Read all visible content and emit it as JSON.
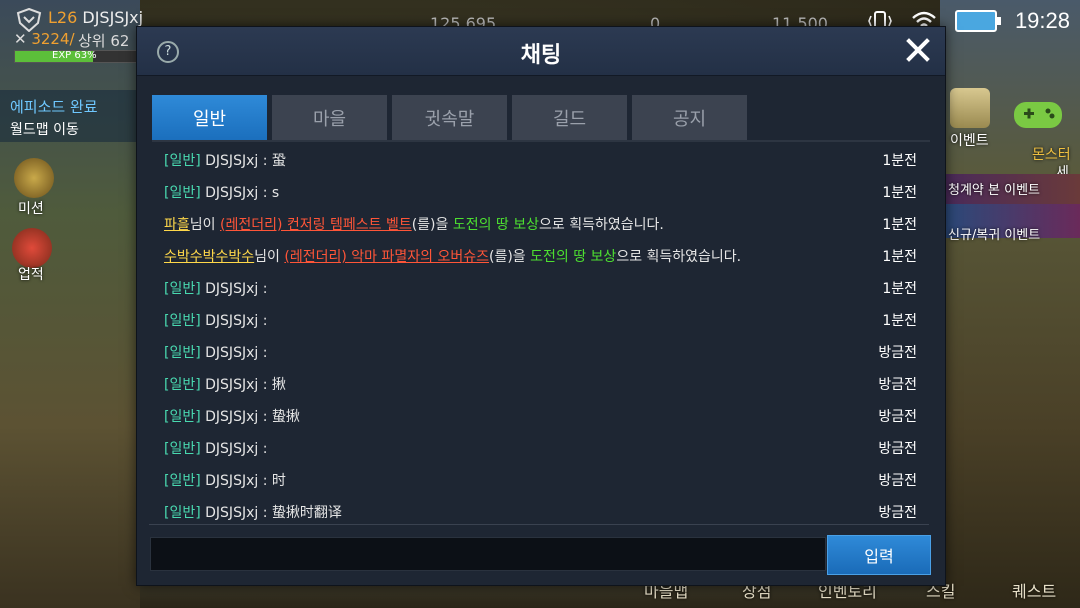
{
  "status_bar": {
    "time": "19:28"
  },
  "hud": {
    "level_name": "DJSJSJxj",
    "level_prefix": "L",
    "level_number": "26",
    "combat": "3224/",
    "rank": "상위 62",
    "exp_label": "EXP 63%",
    "exp_percent": 63,
    "currency_1": "125,695",
    "currency_2": "0",
    "currency_3": "11,500",
    "episode_title": "에피소드 완료",
    "episode_sub": "월드맵 이동",
    "side_mission": "미션",
    "side_achievement": "업적",
    "right_event": "이벤트",
    "right_monster": "몬스터",
    "right_guide": "세시",
    "banner_1": "청계약 본 이벤트",
    "banner_2": "신규/복귀 이벤트",
    "bottom_nav": [
      "마을맵",
      "상점",
      "인벤토리",
      "스킬",
      "퀘스트"
    ]
  },
  "modal": {
    "title": "채팅",
    "help_label": "?",
    "tabs": [
      "일반",
      "마을",
      "귓속말",
      "길드",
      "공지"
    ],
    "active_tab": 0,
    "send_label": "입력",
    "input_value": ""
  },
  "messages": [
    {
      "type": "normal",
      "tag": "[일반]",
      "text": " DJSJSJxj : 蛩",
      "time": "1분전"
    },
    {
      "type": "normal",
      "tag": "[일반]",
      "text": " DJSJSJxj : s",
      "time": "1분전"
    },
    {
      "type": "system",
      "player": "파흘",
      "p1": "님이 ",
      "item": "(레전더리) 컨저링 템페스트 벨트",
      "p2": "(를)을 ",
      "place": "도전의 땅 보상",
      "p3": "으로 획득하였습니다.",
      "time": "1분전"
    },
    {
      "type": "system",
      "player": "수박수박수박수",
      "p1": "님이 ",
      "item": "(레전더리) 악마 파멸자의 오버슈즈",
      "p2": "(를)을 ",
      "place": "도전의 땅 보상",
      "p3": "으로 획득하였습니다.",
      "time": "1분전"
    },
    {
      "type": "normal",
      "tag": "[일반]",
      "text": " DJSJSJxj :",
      "time": "1분전"
    },
    {
      "type": "normal",
      "tag": "[일반]",
      "text": " DJSJSJxj :",
      "time": "1분전"
    },
    {
      "type": "normal",
      "tag": "[일반]",
      "text": " DJSJSJxj :",
      "time": "방금전"
    },
    {
      "type": "normal",
      "tag": "[일반]",
      "text": " DJSJSJxj : 揪",
      "time": "방금전"
    },
    {
      "type": "normal",
      "tag": "[일반]",
      "text": " DJSJSJxj : 蛰揪",
      "time": "방금전"
    },
    {
      "type": "normal",
      "tag": "[일반]",
      "text": " DJSJSJxj :",
      "time": "방금전"
    },
    {
      "type": "normal",
      "tag": "[일반]",
      "text": " DJSJSJxj : 时",
      "time": "방금전"
    },
    {
      "type": "normal",
      "tag": "[일반]",
      "text": " DJSJSJxj : 蛰揪时翻译",
      "time": "방금전"
    }
  ],
  "colors": {
    "accent": "#1b6fbd",
    "tag": "#49d9b0",
    "player": "#ffd84a",
    "item": "#ff5538",
    "place": "#4de030"
  },
  "icons": [
    "shield-icon",
    "help-icon",
    "close-icon",
    "wifi-icon",
    "vibrate-icon",
    "battery-icon"
  ]
}
